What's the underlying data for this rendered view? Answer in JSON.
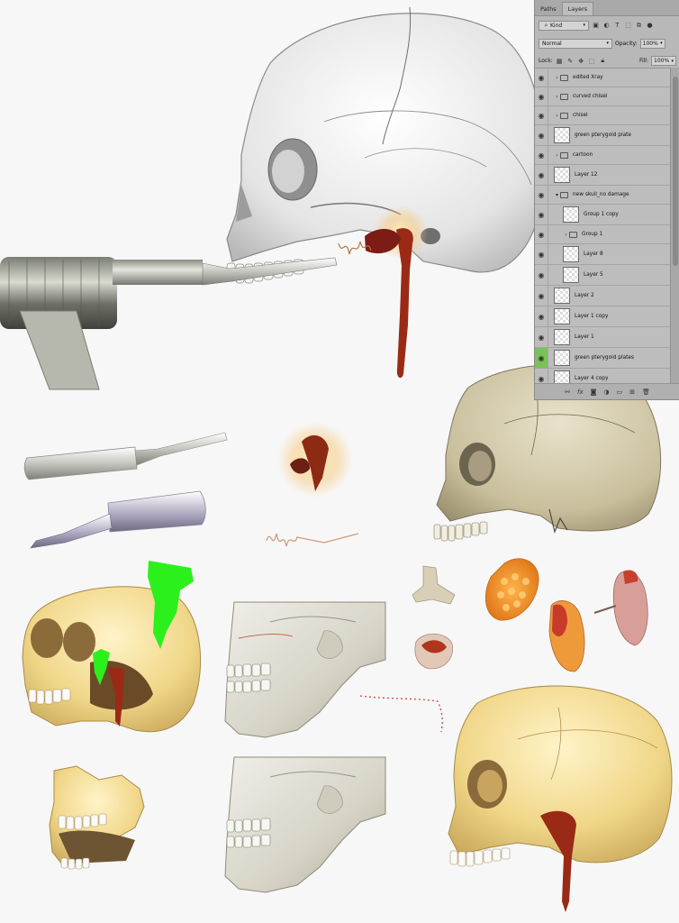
{
  "panel": {
    "tabs": [
      {
        "label": "Paths",
        "active": false
      },
      {
        "label": "Layers",
        "active": true
      }
    ],
    "filter": {
      "label": "Kind"
    },
    "blend_mode": "Normal",
    "opacity_label": "Opacity:",
    "opacity_value": "100%",
    "lock_label": "Lock:",
    "fill_label": "Fill:",
    "fill_value": "100%",
    "layers": [
      {
        "name": "edited Xray",
        "kind": "group",
        "expanded": false,
        "indent": 0
      },
      {
        "name": "curved chisel",
        "kind": "group",
        "expanded": false,
        "indent": 0
      },
      {
        "name": "chisel",
        "kind": "group",
        "expanded": false,
        "indent": 0
      },
      {
        "name": "green pterygoid plate",
        "kind": "layer",
        "indent": 0
      },
      {
        "name": "cartoon",
        "kind": "group",
        "expanded": false,
        "indent": 0
      },
      {
        "name": "Layer 12",
        "kind": "layer",
        "indent": 0
      },
      {
        "name": "new skull_no damage",
        "kind": "group",
        "expanded": true,
        "indent": 0
      },
      {
        "name": "Group 1 copy",
        "kind": "layer",
        "indent": 1
      },
      {
        "name": "Group 1",
        "kind": "group",
        "expanded": false,
        "indent": 1
      },
      {
        "name": "Layer 8",
        "kind": "layer",
        "indent": 1
      },
      {
        "name": "Layer 5",
        "kind": "layer",
        "indent": 1
      },
      {
        "name": "Layer 2",
        "kind": "layer",
        "indent": 0
      },
      {
        "name": "Layer 1 copy",
        "kind": "layer",
        "indent": 0
      },
      {
        "name": "Layer 1",
        "kind": "layer",
        "indent": 0
      },
      {
        "name": "green pterygoid plates",
        "kind": "layer",
        "indent": 0,
        "highlight": true
      },
      {
        "name": "Layer 4 copy",
        "kind": "layer",
        "indent": 0
      }
    ],
    "toolbar_icons": [
      "link-icon",
      "fx-icon",
      "mask-icon",
      "adjustment-icon",
      "folder-icon",
      "new-layer-icon",
      "trash-icon"
    ]
  },
  "colors": {
    "panel_bg": "#b8b8b8",
    "highlight": "#78c25a",
    "green_plate": "#2bf01c",
    "blood": "#9a2a16"
  }
}
